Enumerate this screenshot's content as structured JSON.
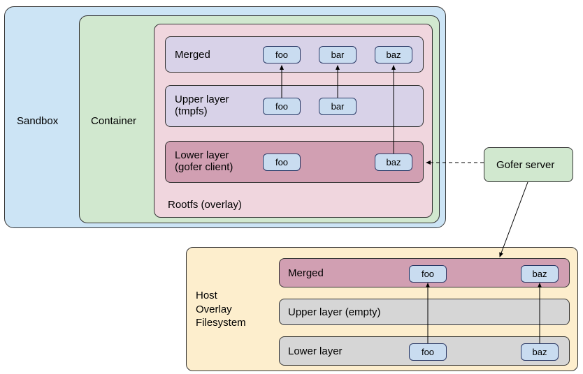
{
  "sandbox": {
    "label": "Sandbox"
  },
  "container": {
    "label": "Container"
  },
  "rootfs": {
    "label": "Rootfs (overlay)"
  },
  "layers": {
    "merged": {
      "label": "Merged",
      "files": [
        "foo",
        "bar",
        "baz"
      ]
    },
    "upper": {
      "label": "Upper layer\n(tmpfs)",
      "files": [
        "foo",
        "bar"
      ]
    },
    "lower": {
      "label": "Lower layer\n(gofer client)",
      "files": [
        "foo",
        "baz"
      ]
    }
  },
  "gofer": {
    "label": "Gofer server"
  },
  "host": {
    "label": "Host\nOverlay\nFilesystem",
    "merged": {
      "label": "Merged",
      "files": [
        "foo",
        "baz"
      ]
    },
    "upper": {
      "label": "Upper layer   (empty)"
    },
    "lower": {
      "label": "Lower layer",
      "files": [
        "foo",
        "baz"
      ]
    }
  }
}
